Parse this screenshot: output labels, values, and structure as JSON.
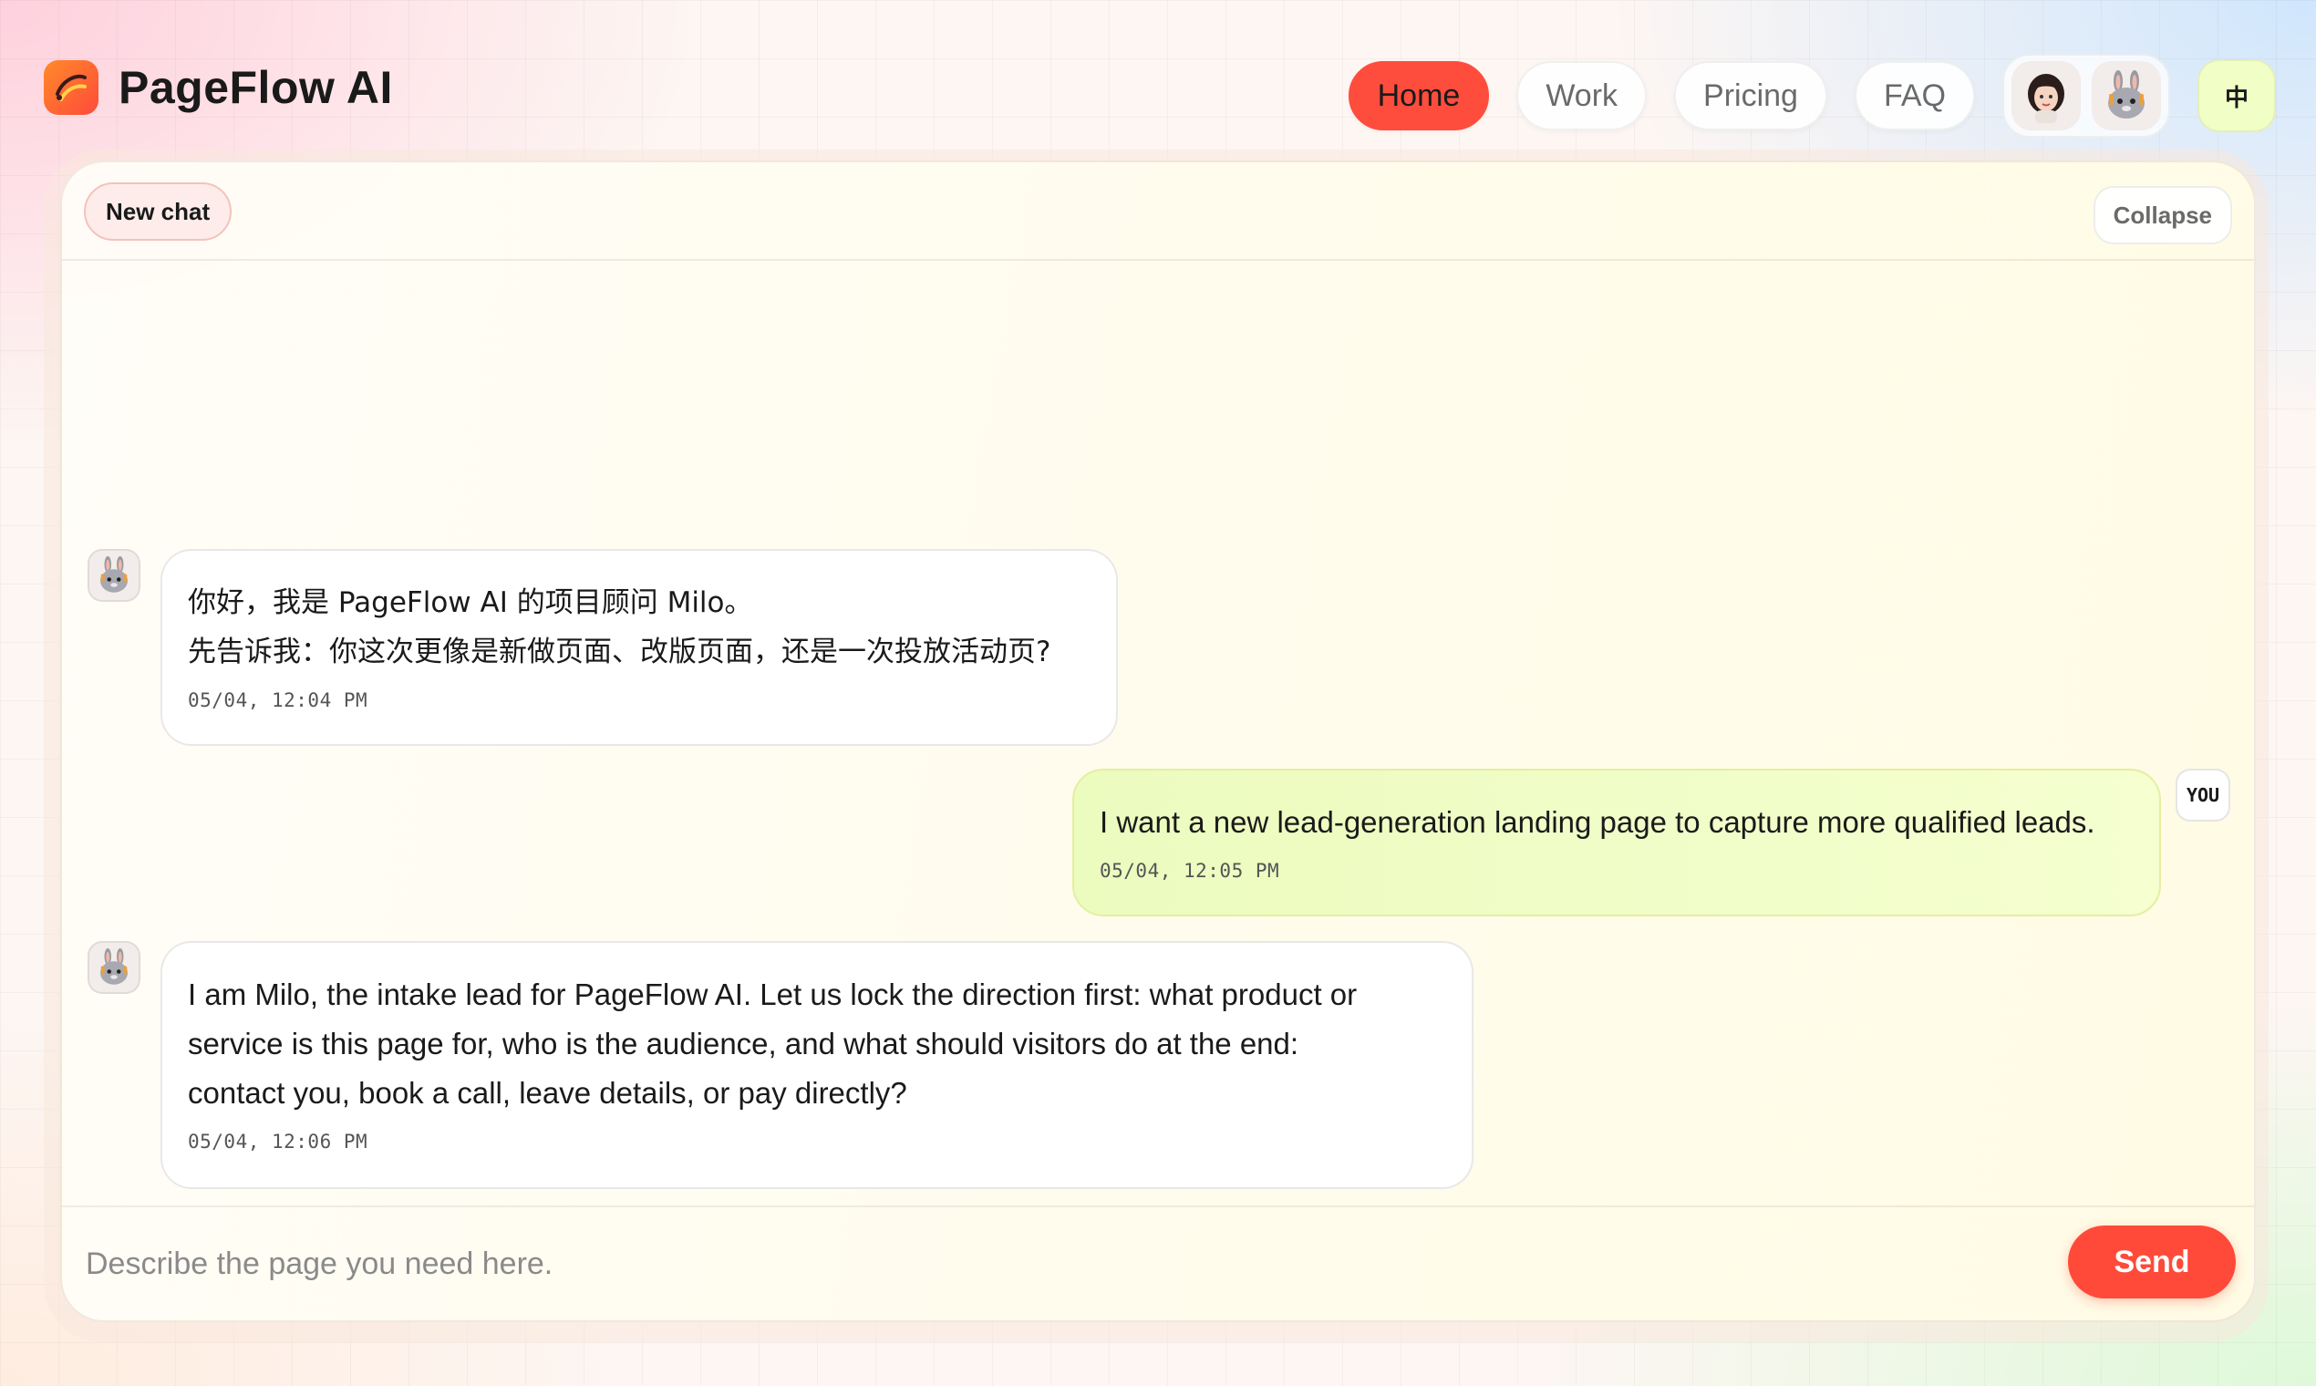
{
  "brand": {
    "name": "PageFlow AI",
    "logo_icon": "logo-swirl-icon",
    "accent": "#ff4d3d"
  },
  "nav": {
    "items": [
      {
        "label": "Home",
        "active": true
      },
      {
        "label": "Work",
        "active": false
      },
      {
        "label": "Pricing",
        "active": false
      },
      {
        "label": "FAQ",
        "active": false
      }
    ],
    "avatars": [
      "woman-avatar-icon",
      "bunny-avatar-icon"
    ],
    "language_label": "中"
  },
  "chat": {
    "new_chat_label": "New chat",
    "collapse_label": "Collapse",
    "messages": [
      {
        "role": "assistant",
        "avatar": "bunny-avatar-icon",
        "text": "你好，我是 PageFlow AI 的项目顾问 Milo。\n先告诉我：你这次更像是新做页面、改版页面，还是一次投放活动页?",
        "time": "05/04, 12:04 PM"
      },
      {
        "role": "user",
        "badge": "YOU",
        "text": "I want a new lead-generation landing page to capture more qualified leads.",
        "time": "05/04, 12:05 PM"
      },
      {
        "role": "assistant",
        "avatar": "bunny-avatar-icon",
        "text": "I am Milo, the intake lead for PageFlow AI. Let us lock the direction first: what product or\nservice is this page for, who is the audience, and what should visitors do at the end:\ncontact you, book a call, leave details, or pay directly?",
        "time": "05/04, 12:06 PM"
      }
    ],
    "composer": {
      "placeholder": "Describe the page you need here.",
      "value": "",
      "send_label": "Send"
    }
  }
}
